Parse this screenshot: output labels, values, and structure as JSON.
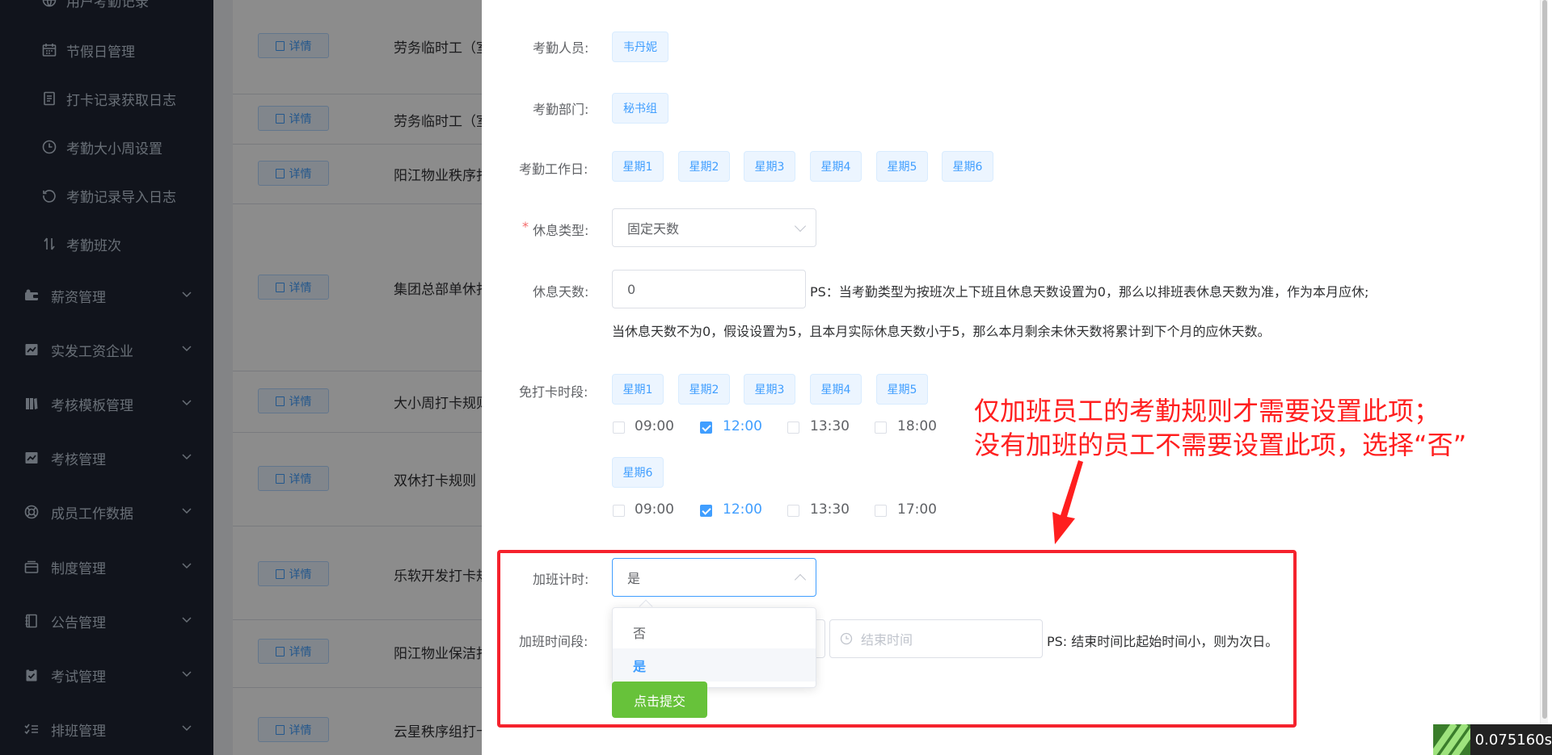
{
  "sidebar": {
    "sub_items": [
      {
        "label": "用户考勤记录",
        "icon": "globe-icon"
      },
      {
        "label": "节假日管理",
        "icon": "calendar-icon"
      },
      {
        "label": "打卡记录获取日志",
        "icon": "document-icon"
      },
      {
        "label": "考勤大小周设置",
        "icon": "clock-icon"
      },
      {
        "label": "考勤记录导入日志",
        "icon": "refresh-icon"
      },
      {
        "label": "考勤班次",
        "icon": "sort-icon"
      }
    ],
    "menus": [
      {
        "label": "薪资管理",
        "icon": "wallet-icon"
      },
      {
        "label": "实发工资企业",
        "icon": "chart-icon"
      },
      {
        "label": "考核模板管理",
        "icon": "template-icon"
      },
      {
        "label": "考核管理",
        "icon": "chart-icon"
      },
      {
        "label": "成员工作数据",
        "icon": "lifebuoy-icon"
      },
      {
        "label": "制度管理",
        "icon": "briefcase-icon"
      },
      {
        "label": "公告管理",
        "icon": "notebook-icon"
      },
      {
        "label": "考试管理",
        "icon": "clipboard-icon"
      },
      {
        "label": "排班管理",
        "icon": "list-check-icon"
      }
    ]
  },
  "table": {
    "detail_label": "详情",
    "rows": [
      "劳务临时工（室",
      "劳务临时工（室",
      "阳江物业秩序打",
      "集团总部单休打",
      "大小周打卡规则",
      "双休打卡规则",
      "乐软开发打卡规",
      "阳江物业保洁打",
      "云星秩序组打卡"
    ]
  },
  "form": {
    "staff_label": "考勤人员:",
    "staff_tag": "韦丹妮",
    "dept_label": "考勤部门:",
    "dept_tag": "秘书组",
    "workdays_label": "考勤工作日:",
    "workdays": [
      "星期1",
      "星期2",
      "星期3",
      "星期4",
      "星期5",
      "星期6"
    ],
    "required_mark": "*",
    "rest_type_label": "休息类型:",
    "rest_type_value": "固定天数",
    "rest_days_label": "休息天数:",
    "rest_days_value": "0",
    "rest_note_1": "PS：当考勤类型为按班次上下班且休息天数设置为0，那么以排班表休息天数为准，作为本月应休;",
    "rest_note_2": "当休息天数不为0，假设设置为5，且本月实际休息天数小于5，那么本月剩余未休天数将累计到下个月的应休天数。",
    "free_label": "免打卡时段:",
    "free_days_a": [
      "星期1",
      "星期2",
      "星期3",
      "星期4",
      "星期5"
    ],
    "free_times_a": [
      {
        "time": "09:00",
        "checked": false
      },
      {
        "time": "12:00",
        "checked": true
      },
      {
        "time": "13:30",
        "checked": false
      },
      {
        "time": "18:00",
        "checked": false
      }
    ],
    "free_days_b": [
      "星期6"
    ],
    "free_times_b": [
      {
        "time": "09:00",
        "checked": false
      },
      {
        "time": "12:00",
        "checked": true
      },
      {
        "time": "13:30",
        "checked": false
      },
      {
        "time": "17:00",
        "checked": false
      }
    ],
    "overtime_label": "加班计时:",
    "overtime_value": "是",
    "overtime_options": [
      "否",
      "是"
    ],
    "overtime_period_label": "加班时间段:",
    "end_time_placeholder": "结束时间",
    "overtime_note": "PS: 结束时间比起始时间小，则为次日。",
    "submit_label": "点击提交"
  },
  "annotation": {
    "line1": "仅加班员工的考勤规则才需要设置此项；",
    "line2": "没有加班的员工不需要设置此项，选择“否”"
  },
  "timer": "0.075160s",
  "colors": {
    "accent": "#409eff",
    "success": "#67c23a",
    "annotation": "#ff1f1f",
    "sidebar": "#1f2633"
  }
}
